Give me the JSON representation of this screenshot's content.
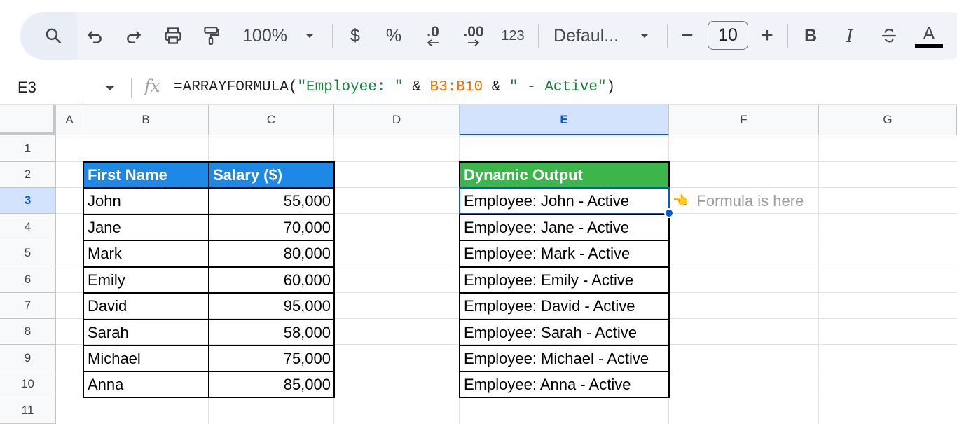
{
  "toolbar": {
    "zoom": "100%",
    "currency": "$",
    "percent": "%",
    "decrease_decimal": ".0",
    "increase_decimal": ".00",
    "more_formats": "123",
    "font": "Defaul...",
    "font_size": "10",
    "minus": "−",
    "plus": "+",
    "bold": "B",
    "italic": "I",
    "text_color": "A"
  },
  "formula_bar": {
    "name_box": "E3",
    "fx": "fx",
    "formula_parts": {
      "fn": "=ARRAYFORMULA(",
      "str1": "\"Employee: \"",
      "amp1": " & ",
      "ref": "B3:B10",
      "amp2": " & ",
      "str2": "\" - Active\"",
      "close": ")"
    }
  },
  "columns": [
    "A",
    "B",
    "C",
    "D",
    "E",
    "F",
    "G"
  ],
  "rows": [
    "1",
    "2",
    "3",
    "4",
    "5",
    "6",
    "7",
    "8",
    "9",
    "10",
    "11"
  ],
  "selected_column": "E",
  "selected_row": "3",
  "table_left": {
    "headers": [
      "First Name",
      "Salary ($)"
    ],
    "rows": [
      {
        "name": "John",
        "salary": "55,000"
      },
      {
        "name": "Jane",
        "salary": "70,000"
      },
      {
        "name": "Mark",
        "salary": "80,000"
      },
      {
        "name": "Emily",
        "salary": "60,000"
      },
      {
        "name": "David",
        "salary": "95,000"
      },
      {
        "name": "Sarah",
        "salary": "58,000"
      },
      {
        "name": "Michael",
        "salary": "75,000"
      },
      {
        "name": "Anna",
        "salary": "85,000"
      }
    ]
  },
  "table_right": {
    "header": "Dynamic Output",
    "rows": [
      "Employee: John - Active",
      "Employee: Jane - Active",
      "Employee: Mark - Active",
      "Employee: Emily - Active",
      "Employee: David - Active",
      "Employee: Sarah - Active",
      "Employee: Michael - Active",
      "Employee: Anna - Active"
    ]
  },
  "note": {
    "icon": "👈",
    "text": "Formula is here"
  },
  "colors": {
    "blue_header": "#1e88e5",
    "green_header": "#3cb64a",
    "selection": "#0b57d0",
    "formula_string": "#188038",
    "formula_ref": "#e8710a"
  }
}
